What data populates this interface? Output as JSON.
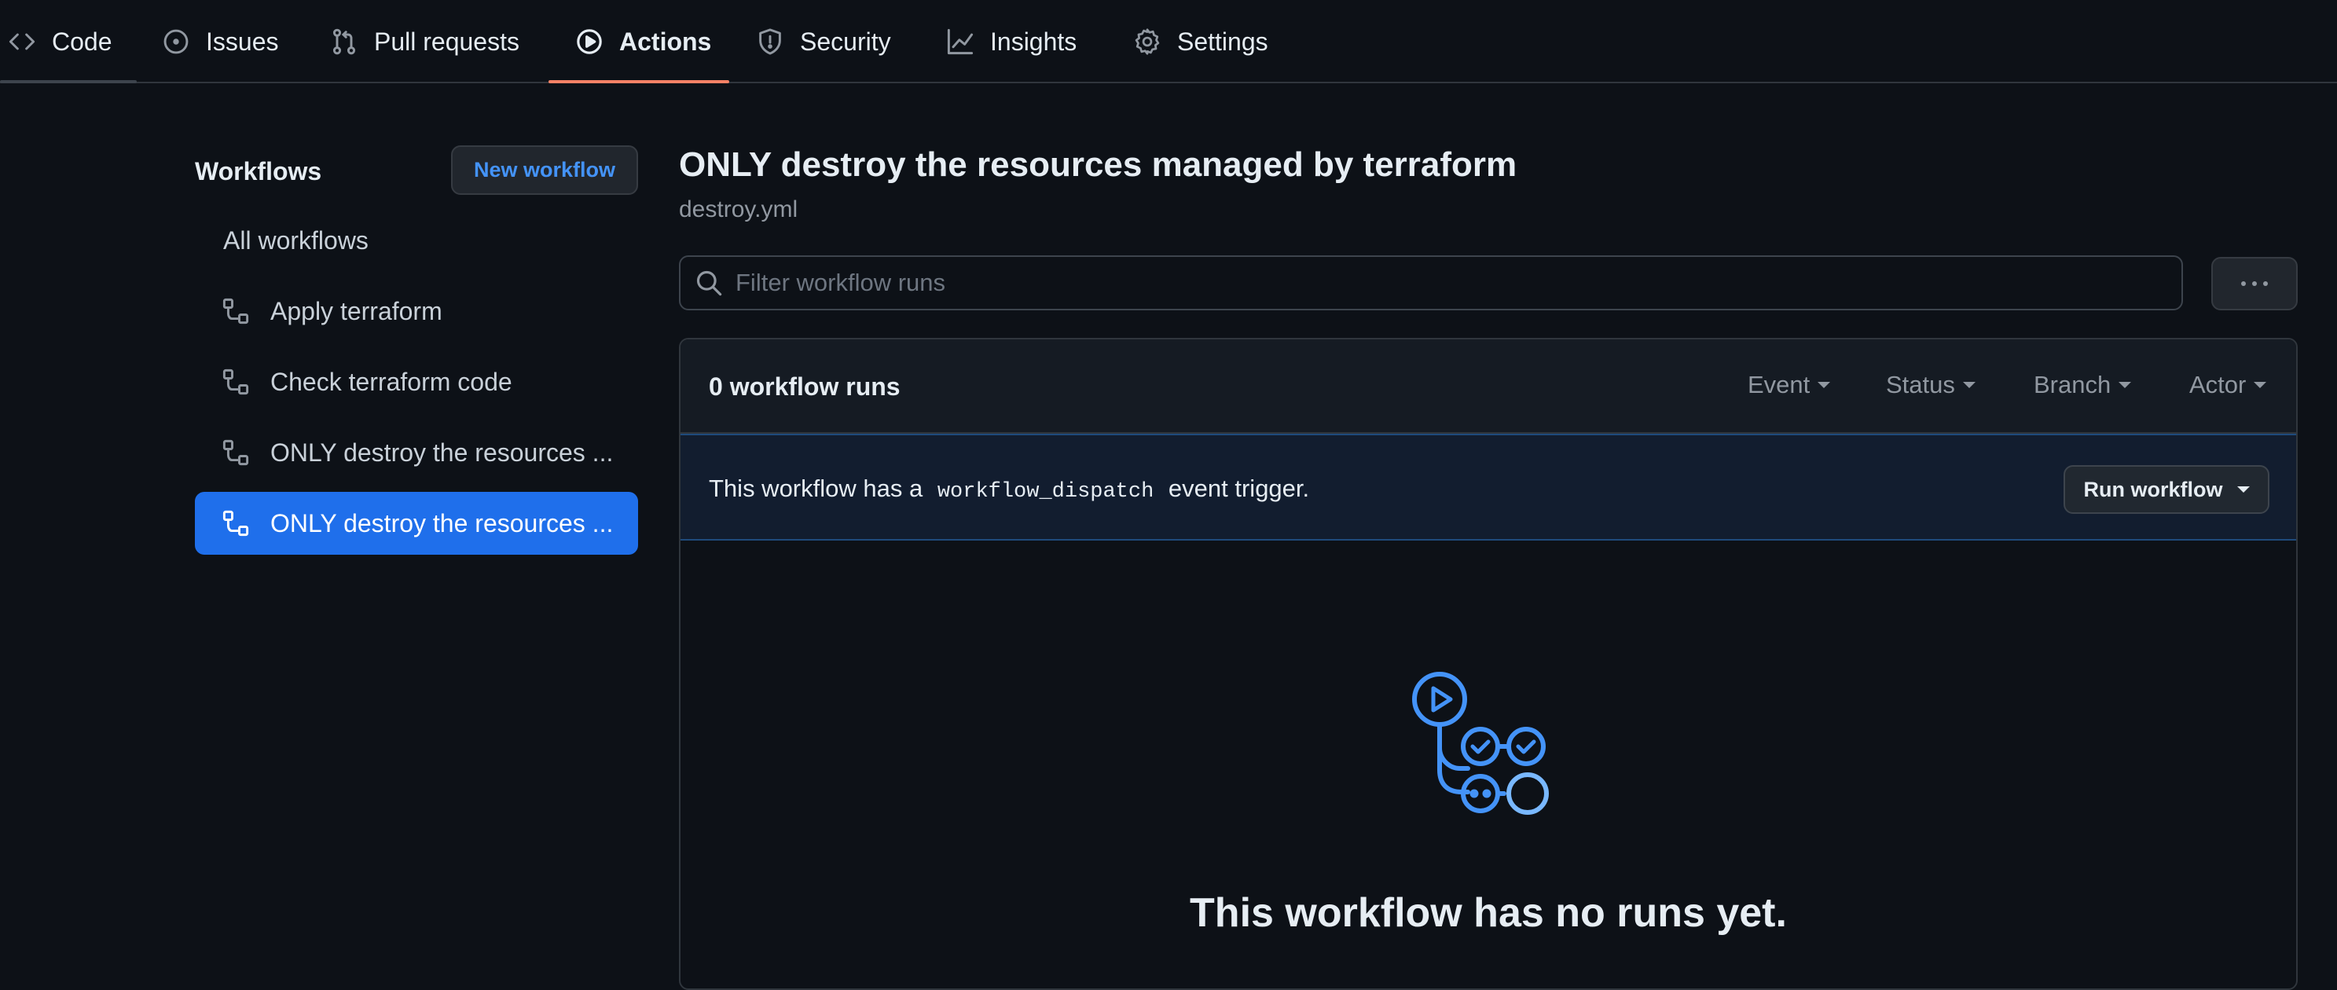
{
  "nav": {
    "tabs": [
      {
        "label": "Code",
        "icon": "code-icon"
      },
      {
        "label": "Issues",
        "icon": "issue-icon"
      },
      {
        "label": "Pull requests",
        "icon": "pull-request-icon"
      },
      {
        "label": "Actions",
        "icon": "play-icon",
        "active": true
      },
      {
        "label": "Security",
        "icon": "shield-icon"
      },
      {
        "label": "Insights",
        "icon": "graph-icon"
      },
      {
        "label": "Settings",
        "icon": "gear-icon"
      }
    ],
    "active_color": "#f78166"
  },
  "sidebar": {
    "title": "Workflows",
    "new_workflow_label": "New workflow",
    "items": [
      {
        "label": "All workflows"
      },
      {
        "label": "Apply terraform",
        "icon": "workflow-icon"
      },
      {
        "label": "Check terraform code",
        "icon": "workflow-icon"
      },
      {
        "label": "ONLY destroy the resources ...",
        "icon": "workflow-icon"
      },
      {
        "label": "ONLY destroy the resources ...",
        "icon": "workflow-icon",
        "selected": true
      }
    ]
  },
  "main": {
    "title": "ONLY destroy the resources managed by terraform",
    "file": "destroy.yml",
    "filter_placeholder": "Filter workflow runs",
    "more_label": "···",
    "runs_count": "0 workflow runs",
    "filters": [
      "Event",
      "Status",
      "Branch",
      "Actor"
    ],
    "banner": {
      "prefix": "This workflow has a",
      "code": "workflow_dispatch",
      "suffix": "event trigger."
    },
    "run_workflow_label": "Run workflow",
    "empty_title": "This workflow has no runs yet.",
    "accent": "#4493f8"
  }
}
